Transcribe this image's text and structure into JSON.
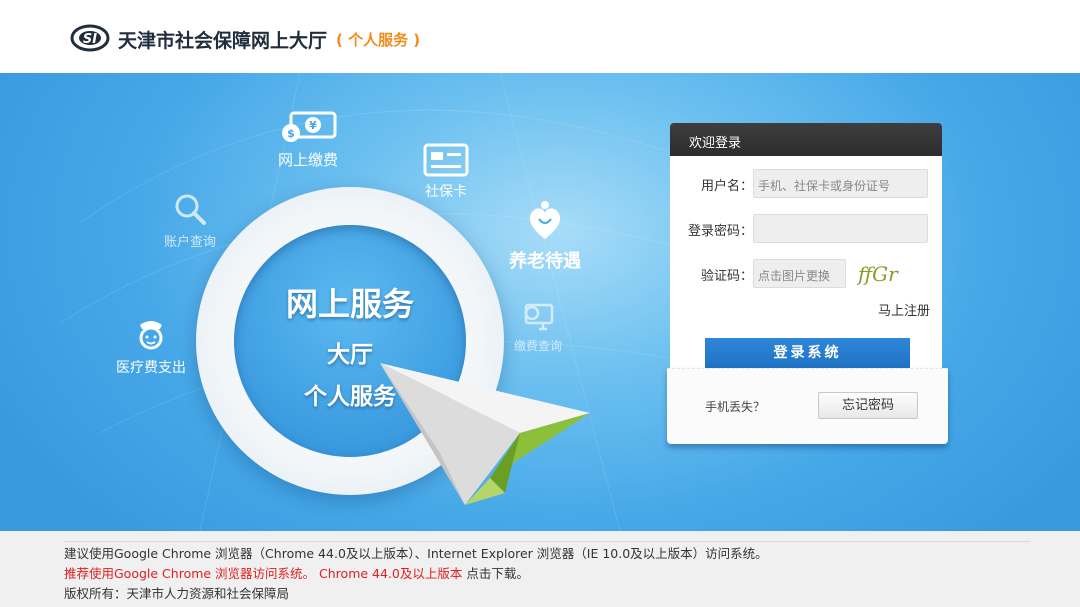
{
  "header": {
    "logo_text": "SI",
    "title": "天津市社会保障网上大厅",
    "subtitle": "( 个人服务 )"
  },
  "banner": {
    "center_title": "网上服务",
    "center_line2": "大厅",
    "center_line3": "个人服务",
    "features": {
      "pay": "网上缴费",
      "card": "社保卡",
      "account_query": "账户查询",
      "pension": "养老待遇",
      "medical": "医疗费支出",
      "fee_query": "缴费查询"
    }
  },
  "login": {
    "title": "欢迎登录",
    "username_label": "用户名：",
    "username_placeholder": "手机、社保卡或身份证号",
    "password_label": "登录密码：",
    "captcha_label": "验证码：",
    "captcha_placeholder": "点击图片更换",
    "captcha_text": "ffGr",
    "register_link": "马上注册",
    "login_button": "登录系统",
    "lost_phone": "手机丢失？",
    "forgot_button": "忘记密码"
  },
  "footer": {
    "line1": "建议使用Google Chrome 浏览器（Chrome 44.0及以上版本）、Internet Explorer 浏览器（IE 10.0及以上版本）访问系统。",
    "line2_red": "推荐使用Google Chrome 浏览器访问系统。 Chrome 44.0及以上版本",
    "line2_plain": " 点击下载。",
    "line3": "版权所有：天津市人力资源和社会保障局"
  },
  "colors": {
    "accent_orange": "#f08c1b",
    "banner_blue": "#45a7e7",
    "login_button": "#1f72c4",
    "footer_red": "#e02020"
  }
}
